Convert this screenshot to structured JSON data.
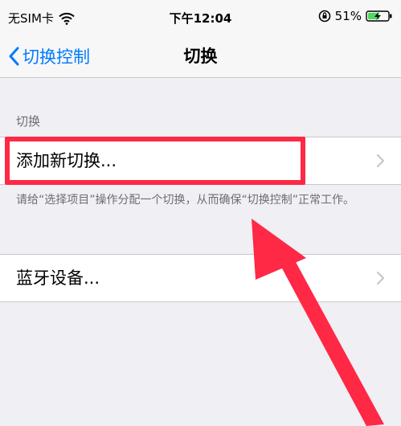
{
  "status_bar": {
    "carrier": "无SIM卡",
    "time": "下午12:04",
    "battery": "51%"
  },
  "nav": {
    "back_label": "切换控制",
    "title": "切换"
  },
  "section": {
    "header": "切换",
    "add_switch_label": "添加新切换...",
    "footer_note": "请给“选择项目”操作分配一个切换，从而确保“切换控制”正常工作。"
  },
  "bluetooth": {
    "label": "蓝牙设备..."
  },
  "colors": {
    "accent": "#007aff",
    "annotation": "#ff2845",
    "background": "#efeff4"
  },
  "icons": [
    "wifi-icon",
    "lock-rotation-icon",
    "battery-charging-icon",
    "back-chevron-icon",
    "chevron-right-icon"
  ]
}
